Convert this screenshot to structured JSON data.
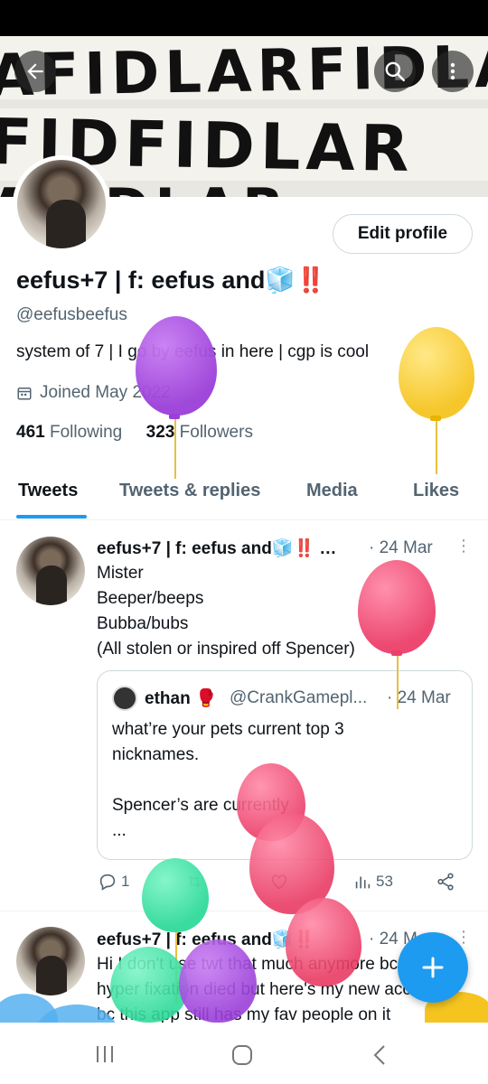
{
  "header": {
    "banner_text_rows": [
      "AFIDLARFIDLAR",
      "FIDFIDLAR",
      "AFIDLAR"
    ],
    "back_icon": "arrow-left-icon",
    "search_icon": "search-icon",
    "more_icon": "more-vertical-icon"
  },
  "profile": {
    "edit_button": "Edit profile",
    "display_name": "eefus+7 | f: eefus and🧊‼️",
    "handle": "@eefusbeefus",
    "bio": "system of 7 | I go by eefus in here | cgp is cool",
    "joined": "Joined May 2022",
    "following_count": "461",
    "following_label": "Following",
    "followers_count": "323",
    "followers_label": "Followers"
  },
  "tabs": [
    {
      "label": "Tweets",
      "active": true
    },
    {
      "label": "Tweets & replies",
      "active": false
    },
    {
      "label": "Media",
      "active": false
    },
    {
      "label": "Likes",
      "active": false
    }
  ],
  "tweets": [
    {
      "name": "eefus+7 | f: eefus and🧊‼️ …",
      "date": "· 24 Mar",
      "lines": [
        "Mister",
        "Beeper/beeps",
        "Bubba/bubs",
        "(All stolen or inspired off Spencer)"
      ],
      "quote": {
        "name": "ethan 🥊",
        "handle": "@CrankGamepl...",
        "date": "· 24 Mar",
        "lines": [
          "what’re your pets current top 3",
          "nicknames.",
          "",
          "Spencer’s are currently",
          "..."
        ]
      },
      "reply_count": "1",
      "views_count": "53"
    },
    {
      "name": "eefus+7 | f: eefus and🧊‼️",
      "date": "· 24 M",
      "lines": [
        "Hi I don't use twt that much anymore bc my",
        "hyper fixation died but here's my new acc",
        "bc this app still has my fav people on it"
      ]
    }
  ],
  "fab": {
    "icon": "plus-icon"
  },
  "nav": {
    "recents_icon": "recents-icon",
    "home_icon": "home-icon",
    "back_icon": "nav-back-icon"
  },
  "colors": {
    "accent": "#1d9bf0",
    "muted": "#536471",
    "text": "#0f1419"
  }
}
